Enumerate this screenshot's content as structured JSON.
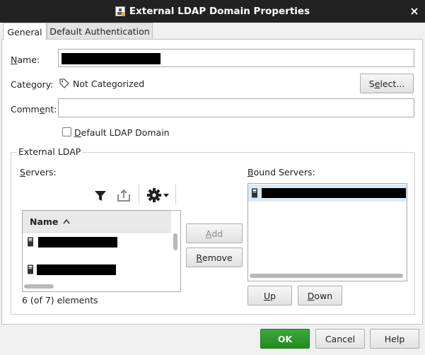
{
  "window": {
    "title": "External LDAP Domain Properties",
    "close_glyph": "×"
  },
  "tabs": [
    {
      "label": "General",
      "active": true
    },
    {
      "label": "Default Authentication",
      "active": false
    }
  ],
  "general": {
    "name_label_pre": "",
    "name_label_u": "N",
    "name_label_post": "ame:",
    "category_label": "Category:",
    "category_value": "Not Categorized",
    "select_button_pre": "S",
    "select_button_u": "e",
    "select_button_post": "lect...",
    "comment_label_pre": "Comm",
    "comment_label_u": "e",
    "comment_label_post": "nt:",
    "default_domain_u": "D",
    "default_domain_post": "efault LDAP Domain",
    "default_domain_checked": false
  },
  "external_ldap": {
    "group_title": "External LDAP",
    "servers_label_u": "S",
    "servers_label_post": "ervers:",
    "name_column": "Name",
    "sort_glyph": "^",
    "elements_count": "6 (of 7) elements",
    "add_u": "A",
    "add_post": "dd",
    "remove_u": "R",
    "remove_post": "emove",
    "bound_label_u": "B",
    "bound_label_post": "ound Servers:",
    "up_u": "U",
    "up_post": "p",
    "down_u": "D",
    "down_post": "own"
  },
  "footer": {
    "ok": "OK",
    "cancel": "Cancel",
    "help": "Help"
  },
  "colors": {
    "ok_green": "#2e9a2a",
    "title_bar": "#222222",
    "selected_row": "#dbeaf8"
  },
  "icons": [
    "ldap-domain-icon",
    "tag-icon",
    "filter-icon",
    "export-icon",
    "gear-icon",
    "server-icon"
  ]
}
